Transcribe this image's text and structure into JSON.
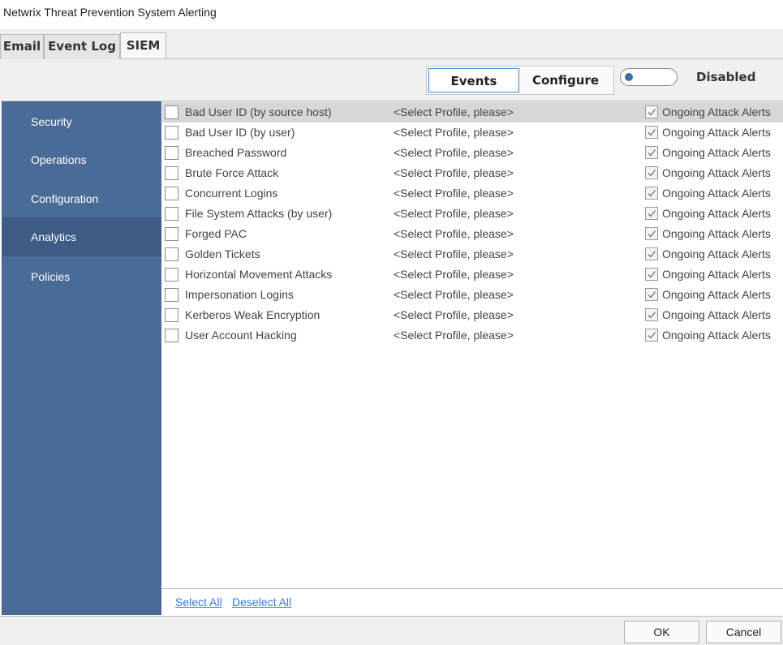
{
  "window": {
    "title": "Netwrix Threat Prevention System Alerting"
  },
  "tabs": [
    {
      "label": "Email"
    },
    {
      "label": "Event Log"
    },
    {
      "label": "SIEM"
    }
  ],
  "toolbar": {
    "events_label": "Events",
    "configure_label": "Configure",
    "toggle_state": "Disabled"
  },
  "sidebar": {
    "items": [
      {
        "label": "Security"
      },
      {
        "label": "Operations"
      },
      {
        "label": "Configuration"
      },
      {
        "label": "Analytics"
      },
      {
        "label": "Policies"
      }
    ],
    "active": "Analytics",
    "color": "#4a6b97"
  },
  "analytics": [
    {
      "name": "Bad User ID (by source host)",
      "profile": "<Select Profile, please>",
      "alert": "Ongoing Attack Alerts",
      "checked": false,
      "alert_checked": true
    },
    {
      "name": "Bad User ID (by user)",
      "profile": "<Select Profile, please>",
      "alert": "Ongoing Attack Alerts",
      "checked": false,
      "alert_checked": true
    },
    {
      "name": "Breached Password",
      "profile": "<Select Profile, please>",
      "alert": "Ongoing Attack Alerts",
      "checked": false,
      "alert_checked": true
    },
    {
      "name": "Brute Force Attack",
      "profile": "<Select Profile, please>",
      "alert": "Ongoing Attack Alerts",
      "checked": false,
      "alert_checked": true
    },
    {
      "name": "Concurrent Logins",
      "profile": "<Select Profile, please>",
      "alert": "Ongoing Attack Alerts",
      "checked": false,
      "alert_checked": true
    },
    {
      "name": "File System Attacks (by user)",
      "profile": "<Select Profile, please>",
      "alert": "Ongoing Attack Alerts",
      "checked": false,
      "alert_checked": true
    },
    {
      "name": "Forged PAC",
      "profile": "<Select Profile, please>",
      "alert": "Ongoing Attack Alerts",
      "checked": false,
      "alert_checked": true
    },
    {
      "name": "Golden Tickets",
      "profile": "<Select Profile, please>",
      "alert": "Ongoing Attack Alerts",
      "checked": false,
      "alert_checked": true
    },
    {
      "name": "Horizontal Movement Attacks",
      "profile": "<Select Profile, please>",
      "alert": "Ongoing Attack Alerts",
      "checked": false,
      "alert_checked": true
    },
    {
      "name": "Impersonation Logins",
      "profile": "<Select Profile, please>",
      "alert": "Ongoing Attack Alerts",
      "checked": false,
      "alert_checked": true
    },
    {
      "name": "Kerberos Weak Encryption",
      "profile": "<Select Profile, please>",
      "alert": "Ongoing Attack Alerts",
      "checked": false,
      "alert_checked": true
    },
    {
      "name": "User Account Hacking",
      "profile": "<Select Profile, please>",
      "alert": "Ongoing Attack Alerts",
      "checked": false,
      "alert_checked": true
    }
  ],
  "footer": {
    "select_all": "Select All",
    "deselect_all": "Deselect All"
  },
  "buttons": {
    "ok": "OK",
    "cancel": "Cancel"
  }
}
